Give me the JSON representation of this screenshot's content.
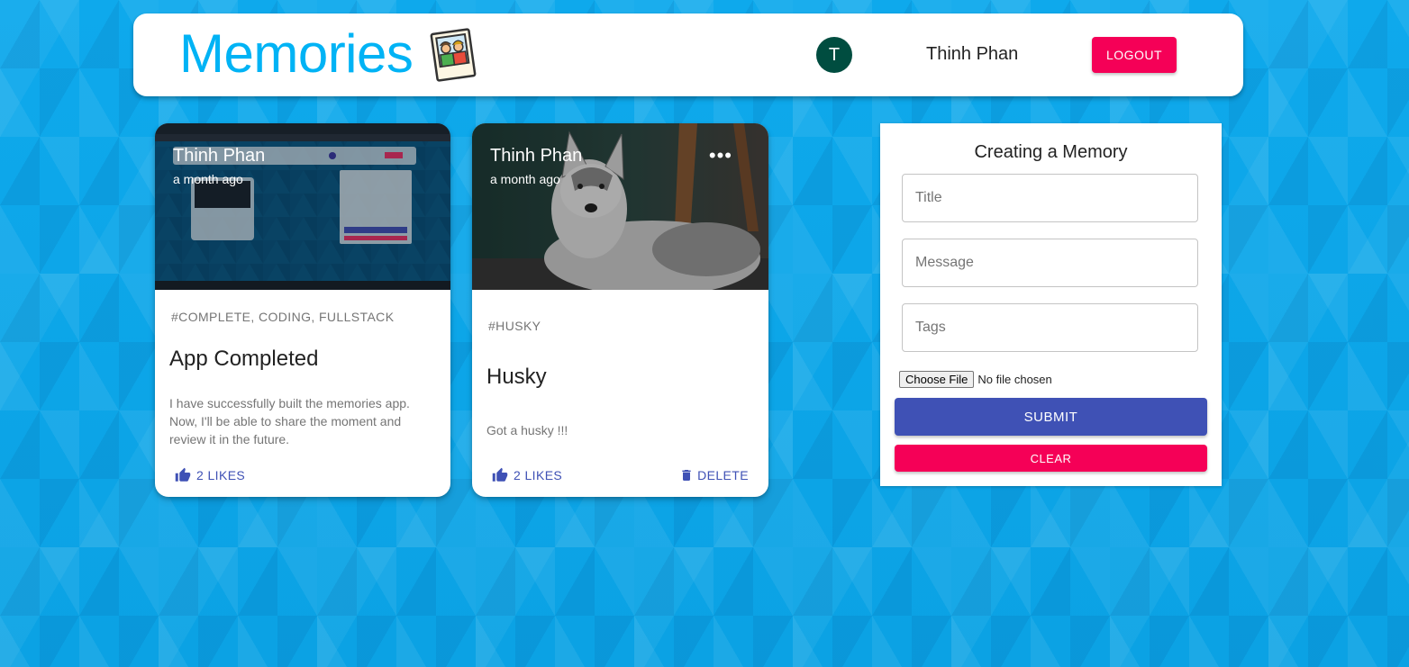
{
  "header": {
    "brand": "Memories",
    "logo_icon": "memories-photo-icon",
    "avatar_initial": "T",
    "username": "Thinh Phan",
    "logout_label": "LOGOUT",
    "colors": {
      "brand": "#00b3f5",
      "logout": "#f50057",
      "avatar": "#004d40"
    }
  },
  "posts": [
    {
      "creator": "Thinh Phan",
      "time": "a month ago",
      "tags": "#COMPLETE, CODING, FULLSTACK",
      "title": "App Completed",
      "message": "I have successfully built the memories app. Now, I'll be able to share the moment and review it in the future.",
      "likes": "2 LIKES",
      "image": "app-screenshot"
    },
    {
      "creator": "Thinh Phan",
      "time": "a month ago",
      "tags": "#HUSKY",
      "title": "Husky",
      "message": "Got a husky !!!",
      "likes": "2 LIKES",
      "delete_label": "DELETE",
      "more_icon": "more-horiz-icon",
      "image": "husky-photo"
    }
  ],
  "form": {
    "title": "Creating a Memory",
    "title_placeholder": "Title",
    "message_placeholder": "Message",
    "tags_placeholder": "Tags",
    "file_button": "Choose File",
    "file_status": "No file chosen",
    "submit_label": "SUBMIT",
    "clear_label": "CLEAR",
    "colors": {
      "submit": "#3f51b5",
      "clear": "#f50057"
    }
  }
}
